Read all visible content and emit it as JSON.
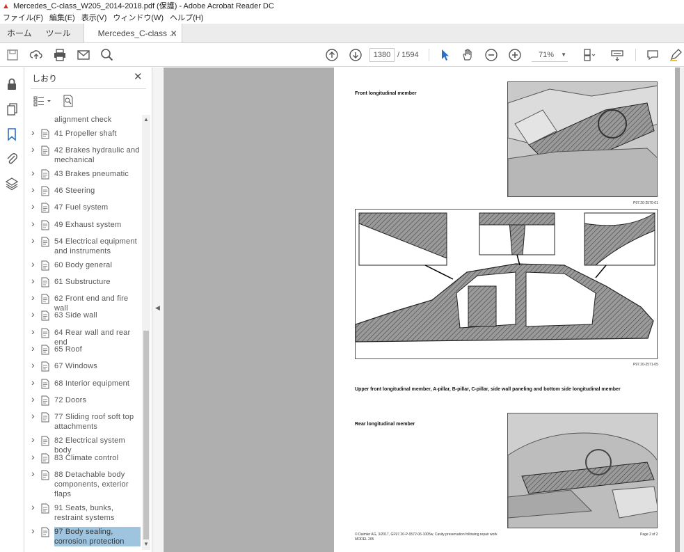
{
  "window": {
    "title": "Mercedes_C-class_W205_2014-2018.pdf (保護) - Adobe Acrobat Reader DC"
  },
  "menu": [
    "ファイル(F)",
    "編集(E)",
    "表示(V)",
    "ウィンドウ(W)",
    "ヘルプ(H)"
  ],
  "tabs": {
    "home": "ホーム",
    "tools": "ツール",
    "document": "Mercedes_C-class ..."
  },
  "toolbar": {
    "current_page": "1380",
    "page_total": "/ 1594",
    "zoom": "71%"
  },
  "bookmarks": {
    "title": "しおり",
    "items": [
      {
        "label": "alignment check",
        "partial": true
      },
      {
        "label": "41 Propeller shaft"
      },
      {
        "label": "42 Brakes hydraulic and mechanical"
      },
      {
        "label": "43 Brakes pneumatic"
      },
      {
        "label": "46 Steering"
      },
      {
        "label": "47 Fuel system"
      },
      {
        "label": "49 Exhaust system"
      },
      {
        "label": "54 Electrical equipment and instruments"
      },
      {
        "label": "60 Body general"
      },
      {
        "label": "61 Substructure"
      },
      {
        "label": "62 Front end and fire wall"
      },
      {
        "label": "63 Side wall"
      },
      {
        "label": "64 Rear wall and rear end"
      },
      {
        "label": "65 Roof"
      },
      {
        "label": "67 Windows"
      },
      {
        "label": "68 Interior equipment"
      },
      {
        "label": "72 Doors"
      },
      {
        "label": "77 Sliding roof soft top attachments"
      },
      {
        "label": "82 Electrical system body"
      },
      {
        "label": "83 Climate control"
      },
      {
        "label": "88 Detachable body components, exterior flaps"
      },
      {
        "label": "91 Seats, bunks, restraint systems"
      },
      {
        "label": "97 Body sealing, corrosion protection",
        "selected": true
      }
    ]
  },
  "document": {
    "caption_front": "Front longitudinal member",
    "fig1_ref": "P97.20-2570-01",
    "fig2_ref": "P97.20-2571-05",
    "caption_upper": "Upper front longitudinal member, A-pillar, B-pillar, C-pillar, side wall paneling and bottom side longitudinal member",
    "caption_rear": "Rear longitudinal member",
    "footer_left": "© Daimler AG, 3/2017, GF97.20-P-0572-06-1005w, Cavity preservation following repair work",
    "footer_left2": "MODEL 205",
    "footer_right": "Page 2 of 2"
  },
  "colors": {
    "accent": "#d2302b",
    "selection": "#9fc4e0",
    "doc_background": "#afafaf"
  }
}
